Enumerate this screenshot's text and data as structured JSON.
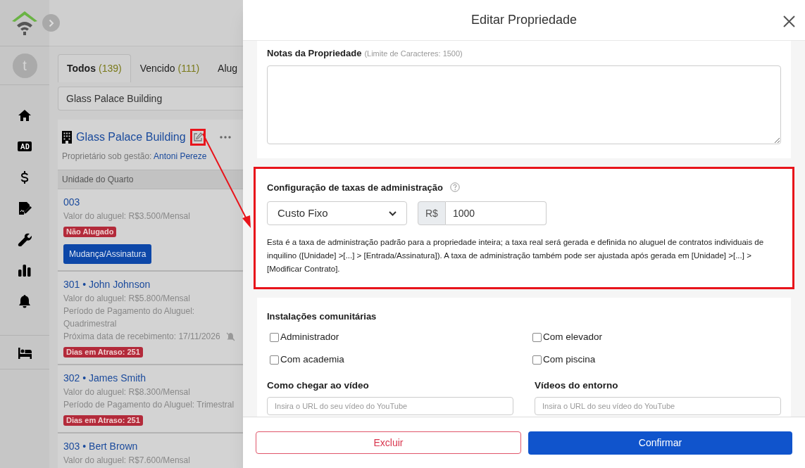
{
  "sidebar": {
    "avatar": "t"
  },
  "tabs": [
    {
      "label": "Todos",
      "count": "(139)",
      "selected": true
    },
    {
      "label": "Vencido",
      "count": "(111)",
      "selected": false
    },
    {
      "label": "Alug",
      "selected": false
    }
  ],
  "search": {
    "value": "Glass Palace Building"
  },
  "building": {
    "name": "Glass Palace Building",
    "owner_label": "Proprietário sob gestão:",
    "owner": "Antoni Pereze",
    "highlighted": true
  },
  "units_header": "Unidade do Quarto",
  "units": [
    {
      "title": "003",
      "lines": [
        "Valor do aluguel: R$3.500/Mensal"
      ],
      "badge": "Não Alugado",
      "button": "Mudança/Assinatura"
    },
    {
      "title": "301 • John Johnson",
      "lines": [
        "Valor do aluguel: R$5.800/Mensal",
        "Período de Pagamento do Aluguel: Quadrimestral",
        "Próxima data de recebimento:  17/11/2026"
      ],
      "reminder_off": true,
      "badge": "Dias em Atraso: 251"
    },
    {
      "title": "302 • James Smith",
      "lines": [
        "Valor do aluguel: R$8.300/Mensal",
        "Período de Pagamento do Aluguel: Trimestral"
      ],
      "badge": "Dias em Atraso: 251"
    },
    {
      "title": "303 • Bert Brown",
      "lines": [
        "Valor do aluguel: R$7.600/Mensal"
      ]
    }
  ],
  "modal": {
    "title": "Editar Propriedade",
    "notes": {
      "label": "Notas da Propriedade",
      "hint": "(Limite de Caracteres: 1500)"
    },
    "fee": {
      "label": "Configuração de taxas de administração",
      "select": "Custo Fixo",
      "prefix": "R$",
      "value": "1000",
      "highlighted": true,
      "description": "Esta é a taxa de administração padrão para a propriedade inteira; a taxa real será gerada e definida no aluguel de contratos individuais de inquilino ([Unidade] >[...] > [Entrada/Assinatura]). A taxa de administração também pode ser ajustada após gerada em [Unidade] >[...] > [Modificar Contrato]."
    },
    "amenities": {
      "label": "Instalações comunitárias",
      "items": [
        {
          "label": "Administrador",
          "checked": false
        },
        {
          "label": "Com elevador",
          "checked": false
        },
        {
          "label": "Com academia",
          "checked": false
        },
        {
          "label": "Com piscina",
          "checked": false
        }
      ]
    },
    "videos": [
      {
        "label": "Como chegar ao vídeo",
        "placeholder": "Insira o URL do seu vídeo do YouTube"
      },
      {
        "label": "Vídeos do entorno",
        "placeholder": "Insira o URL do seu vídeo do YouTube"
      }
    ],
    "buttons": [
      {
        "kind": "danger",
        "label": "Excluir"
      },
      {
        "kind": "primary",
        "label": "Confirmar"
      }
    ]
  }
}
